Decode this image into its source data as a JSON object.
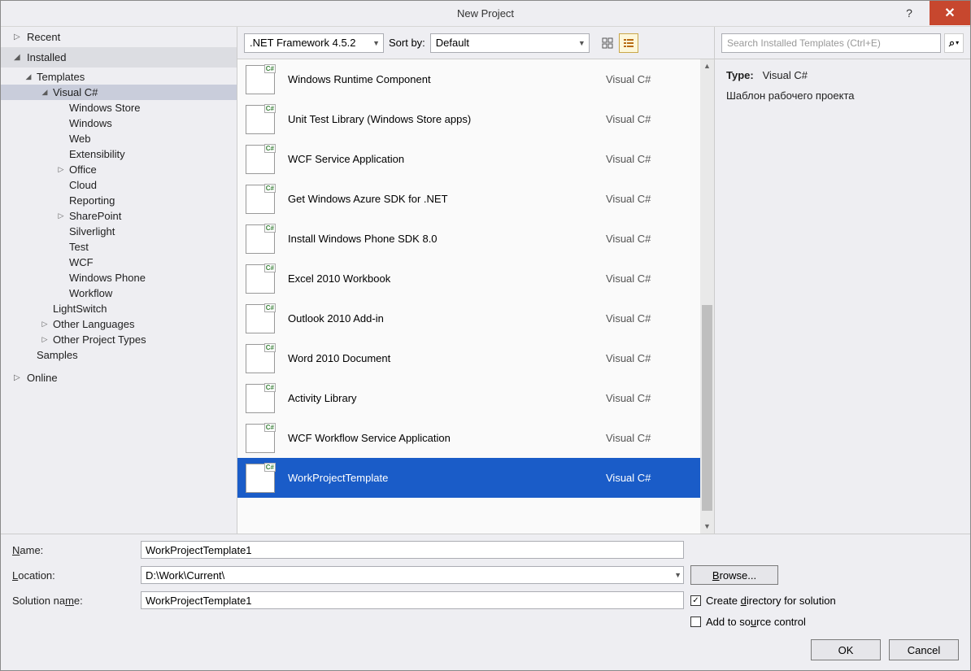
{
  "window": {
    "title": "New Project"
  },
  "sidebar": {
    "sections": {
      "recent": "Recent",
      "installed": "Installed",
      "online": "Online"
    },
    "tree": [
      {
        "label": "Templates",
        "indent": 1,
        "caret": "expanded"
      },
      {
        "label": "Visual C#",
        "indent": 2,
        "caret": "expanded",
        "selected": true
      },
      {
        "label": "Windows Store",
        "indent": 3
      },
      {
        "label": "Windows",
        "indent": 3
      },
      {
        "label": "Web",
        "indent": 3
      },
      {
        "label": "Extensibility",
        "indent": 3
      },
      {
        "label": "Office",
        "indent": 3,
        "caret": "collapsed"
      },
      {
        "label": "Cloud",
        "indent": 3
      },
      {
        "label": "Reporting",
        "indent": 3
      },
      {
        "label": "SharePoint",
        "indent": 3,
        "caret": "collapsed"
      },
      {
        "label": "Silverlight",
        "indent": 3
      },
      {
        "label": "Test",
        "indent": 3
      },
      {
        "label": "WCF",
        "indent": 3
      },
      {
        "label": "Windows Phone",
        "indent": 3
      },
      {
        "label": "Workflow",
        "indent": 3
      },
      {
        "label": "LightSwitch",
        "indent": 2
      },
      {
        "label": "Other Languages",
        "indent": 2,
        "caret": "collapsed"
      },
      {
        "label": "Other Project Types",
        "indent": 2,
        "caret": "collapsed"
      },
      {
        "label": "Samples",
        "indent": 1
      }
    ]
  },
  "toolbar": {
    "framework": ".NET Framework 4.5.2",
    "sortby_label": "Sort by:",
    "sortby_value": "Default"
  },
  "templates": [
    {
      "name": "Windows Runtime Component",
      "lang": "Visual C#"
    },
    {
      "name": "Unit Test Library (Windows Store apps)",
      "lang": "Visual C#"
    },
    {
      "name": "WCF Service Application",
      "lang": "Visual C#"
    },
    {
      "name": "Get Windows Azure SDK for .NET",
      "lang": "Visual C#"
    },
    {
      "name": "Install Windows Phone SDK 8.0",
      "lang": "Visual C#"
    },
    {
      "name": "Excel 2010 Workbook",
      "lang": "Visual C#"
    },
    {
      "name": "Outlook 2010 Add-in",
      "lang": "Visual C#"
    },
    {
      "name": "Word 2010 Document",
      "lang": "Visual C#"
    },
    {
      "name": "Activity Library",
      "lang": "Visual C#"
    },
    {
      "name": "WCF Workflow Service Application",
      "lang": "Visual C#"
    },
    {
      "name": "WorkProjectTemplate",
      "lang": "Visual C#",
      "selected": true
    }
  ],
  "search": {
    "placeholder": "Search Installed Templates (Ctrl+E)"
  },
  "details": {
    "type_label": "Type:",
    "type_value": "Visual C#",
    "description": "Шаблон рабочего проекта"
  },
  "form": {
    "name_label": "Name:",
    "name_value": "WorkProjectTemplate1",
    "location_label": "Location:",
    "location_value": "D:\\Work\\Current\\",
    "solution_label": "Solution name:",
    "solution_value": "WorkProjectTemplate1",
    "browse": "Browse...",
    "create_dir": "Create directory for solution",
    "create_dir_checked": true,
    "add_source": "Add to source control",
    "add_source_checked": false
  },
  "buttons": {
    "ok": "OK",
    "cancel": "Cancel"
  }
}
